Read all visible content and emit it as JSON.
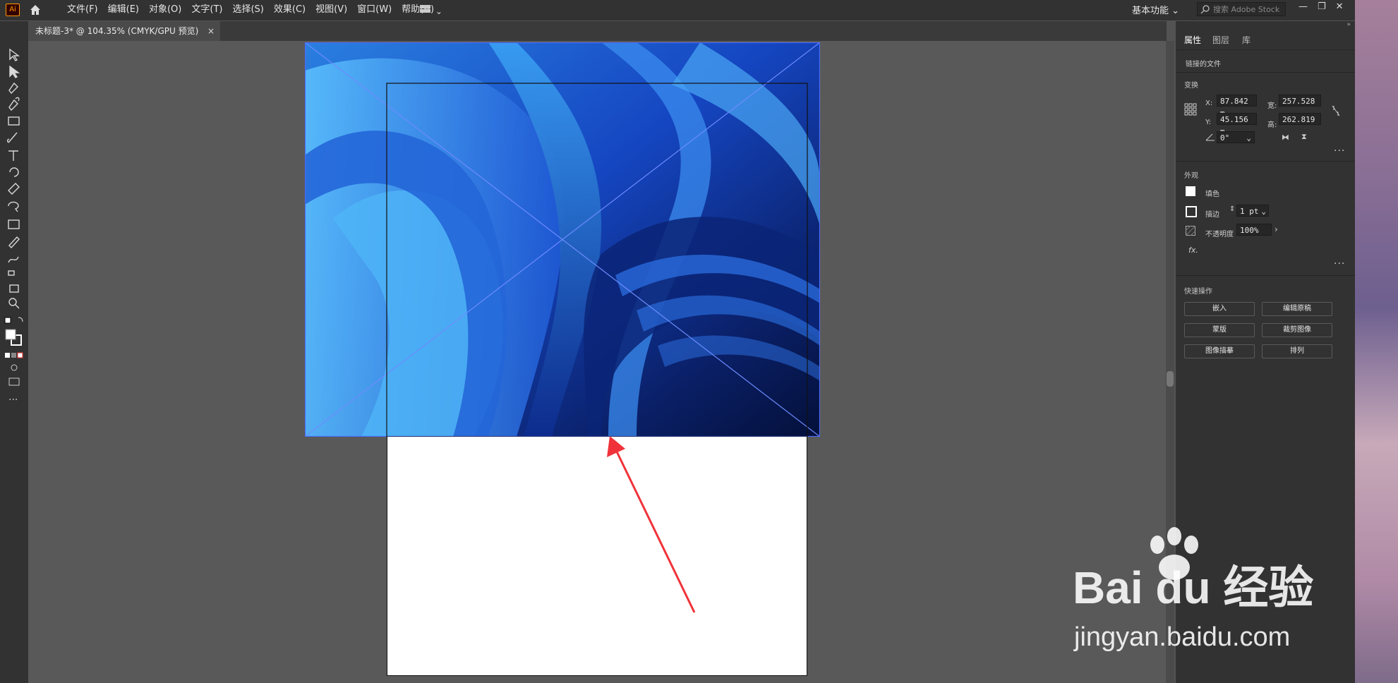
{
  "app": {
    "logo": "Ai",
    "home_icon": "home-icon"
  },
  "menu": [
    "文件(F)",
    "编辑(E)",
    "对象(O)",
    "文字(T)",
    "选择(S)",
    "效果(C)",
    "视图(V)",
    "窗口(W)",
    "帮助(H)"
  ],
  "workspace_label": "基本功能",
  "search": {
    "placeholder": "搜索 Adobe Stock"
  },
  "document_tab": {
    "title": "未标题-3* @ 104.35% (CMYK/GPU 预览)",
    "close": "×"
  },
  "panel": {
    "tabs": [
      "属性",
      "图层",
      "库"
    ],
    "object_type": "链接的文件",
    "transform": {
      "heading": "变换",
      "x_label": "X:",
      "x_value": "87.842 m",
      "y_label": "Y:",
      "y_value": "45.156 m",
      "w_label": "宽:",
      "w_value": "257.528",
      "h_label": "高:",
      "h_value": "262.819",
      "angle_value": "0°"
    },
    "appearance": {
      "heading": "外观",
      "fill_label": "填色",
      "stroke_label": "描边",
      "stroke_value": "1 pt",
      "opacity_label": "不透明度",
      "opacity_value": "100%",
      "fx_label": "fx."
    },
    "quick_actions": {
      "heading": "快速操作",
      "buttons": [
        "嵌入",
        "编辑原稿",
        "蒙版",
        "裁剪图像",
        "图像描摹",
        "排列"
      ]
    }
  },
  "watermark": {
    "brand": "Bai du 经验",
    "url": "jingyan.baidu.com"
  },
  "colors": {
    "accent": "#ff9a00",
    "annotation_arrow": "#f0333a",
    "selection": "#4a6cff"
  }
}
